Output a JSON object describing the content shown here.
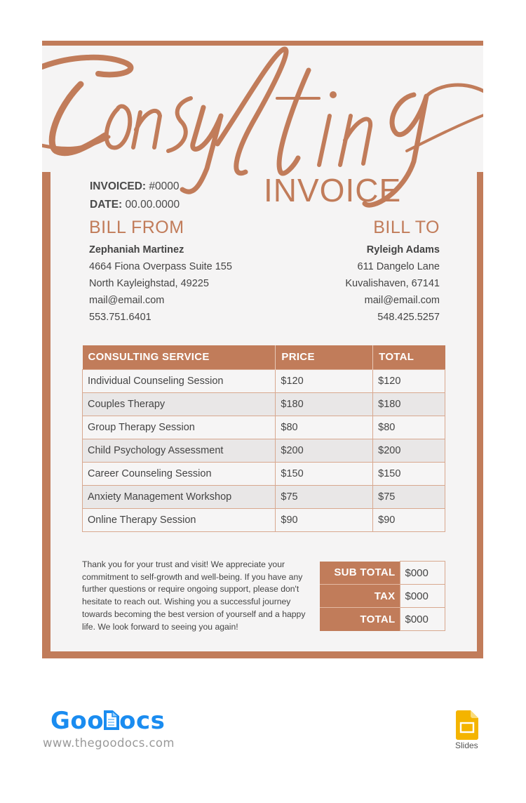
{
  "document": {
    "script_title": "Consulting",
    "title": "INVOICE",
    "invoiced_label": "INVOICED:",
    "invoiced_value": "#0000",
    "date_label": "DATE:",
    "date_value": "00.00.0000",
    "accent_color": "#c17c5a"
  },
  "bill_from": {
    "heading": "BILL FROM",
    "name": "Zephaniah Martinez",
    "address1": "4664 Fiona Overpass Suite 155",
    "address2": "North Kayleighstad, 49225",
    "email": "mail@email.com",
    "phone": "553.751.6401"
  },
  "bill_to": {
    "heading": "BILL TO",
    "name": "Ryleigh Adams",
    "address1": "611 Dangelo Lane",
    "address2": "Kuvalishaven, 67141",
    "email": "mail@email.com",
    "phone": "548.425.5257"
  },
  "items_table": {
    "headers": [
      "CONSULTING SERVICE",
      "PRICE",
      "TOTAL"
    ],
    "rows": [
      [
        "Individual Counseling Session",
        "$120",
        "$120"
      ],
      [
        "Couples Therapy",
        "$180",
        "$180"
      ],
      [
        "Group Therapy Session",
        "$80",
        "$80"
      ],
      [
        "Child Psychology Assessment",
        "$200",
        "$200"
      ],
      [
        "Career Counseling Session",
        "$150",
        "$150"
      ],
      [
        "Anxiety Management Workshop",
        "$75",
        "$75"
      ],
      [
        "Online Therapy Session",
        "$90",
        "$90"
      ]
    ]
  },
  "thank_you_note": "Thank you for your trust and visit! We appreciate your commitment to self-growth and well-being. If you have any further questions or require ongoing support, please don't hesitate to reach out. Wishing you a successful journey towards becoming the best version of yourself and a happy life. We look forward to seeing you again!",
  "totals": {
    "subtotal_label": "SUB TOTAL",
    "subtotal_value": "$000",
    "tax_label": "TAX",
    "tax_value": "$000",
    "total_label": "TOTAL",
    "total_value": "$000"
  },
  "footer": {
    "brand_part1": "Goo",
    "brand_part2": "ocs",
    "website": "www.thegoodocs.com",
    "app_label": "Slides",
    "brand_color": "#1a8cf0",
    "app_icon_color": "#f4b400"
  }
}
